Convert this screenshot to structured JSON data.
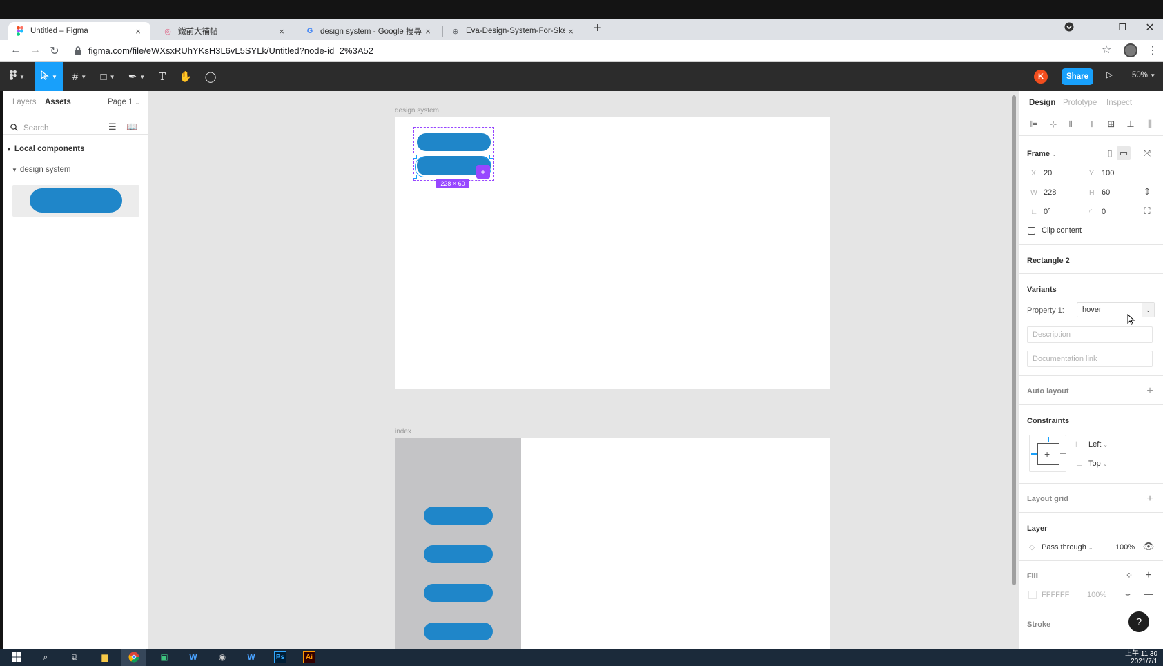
{
  "browser": {
    "tabs": [
      {
        "label": "Untitled – Figma",
        "icon": "figma-icon"
      },
      {
        "label": "鐵前大補帖",
        "icon": "site-icon"
      },
      {
        "label": "design system - Google 搜尋",
        "icon": "google-icon"
      },
      {
        "label": "Eva-Design-System-For-Sketch",
        "icon": "globe-icon"
      }
    ],
    "new_tab": "+",
    "url": "figma.com/file/eWXsxRUhYKsH3L6vL5SYLk/Untitled?node-id=2%3A52"
  },
  "toolbar": {
    "avatar_initial": "K",
    "share_label": "Share",
    "zoom_label": "50%"
  },
  "left_panel": {
    "tabs": [
      "Layers",
      "Assets"
    ],
    "page_selector": "Page 1",
    "search_placeholder": "Search",
    "local_components": "Local components",
    "group_name": "design system"
  },
  "canvas": {
    "frame1_label": "design system",
    "frame2_label": "index",
    "selection_size": "228 × 60"
  },
  "right_panel": {
    "tabs": [
      "Design",
      "Prototype",
      "Inspect"
    ],
    "frame_label": "Frame",
    "x_label": "X",
    "x_value": "20",
    "y_label": "Y",
    "y_value": "100",
    "w_label": "W",
    "w_value": "228",
    "h_label": "H",
    "h_value": "60",
    "rotation_value": "0°",
    "radius_value": "0",
    "clip_content": "Clip content",
    "layer_name": "Rectangle 2",
    "variants_label": "Variants",
    "property_label": "Property 1:",
    "property_value": "hover",
    "description_placeholder": "Description",
    "doc_link_placeholder": "Documentation link",
    "auto_layout": "Auto layout",
    "constraints": "Constraints",
    "constraint_h": "Left",
    "constraint_v": "Top",
    "layout_grid": "Layout grid",
    "layer_section": "Layer",
    "blend_mode": "Pass through",
    "layer_opacity": "100%",
    "fill_section": "Fill",
    "fill_hex": "FFFFFF",
    "fill_opacity": "100%",
    "stroke_section": "Stroke"
  },
  "taskbar": {
    "clock_time": "上午 11:30",
    "clock_date": "2021/7/1"
  },
  "colors": {
    "accent": "#18a0fb",
    "component_blue": "#1f86c9",
    "selection_purple": "#9747ff"
  }
}
